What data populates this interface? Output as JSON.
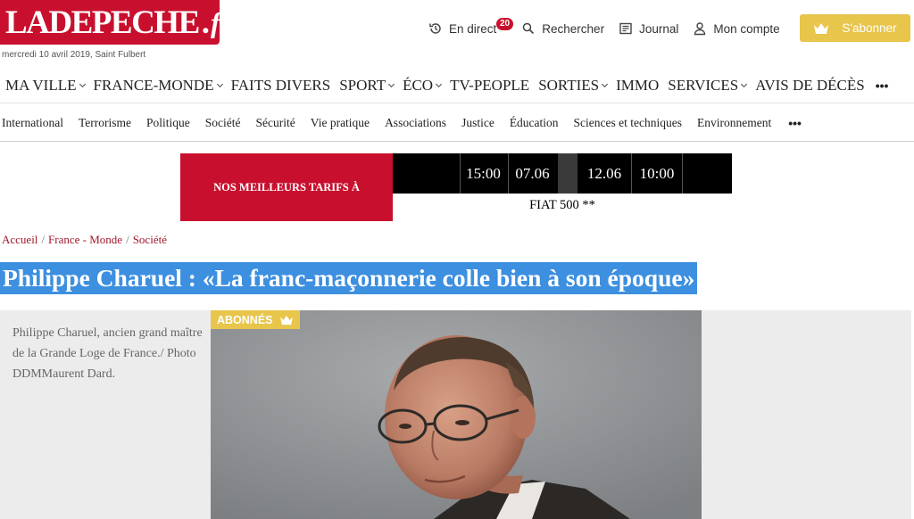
{
  "header": {
    "logo_text": "LADEPECHE",
    "logo_dot": ".",
    "logo_tld": "fr",
    "date": "mercredi 10 avril 2019, Saint Fulbert",
    "actions": {
      "live_label": "En direct",
      "live_count": "20",
      "search_label": "Rechercher",
      "journal_label": "Journal",
      "account_label": "Mon compte"
    },
    "subscribe_label": "S'abonner"
  },
  "main_nav": {
    "items": [
      {
        "label": "MA VILLE"
      },
      {
        "label": "FRANCE-MONDE"
      },
      {
        "label": "FAITS DIVERS"
      },
      {
        "label": "SPORT"
      },
      {
        "label": "ÉCO"
      },
      {
        "label": "TV-PEOPLE"
      },
      {
        "label": "SORTIES"
      },
      {
        "label": "IMMO"
      },
      {
        "label": "SERVICES"
      },
      {
        "label": "AVIS DE DÉCÈS"
      }
    ],
    "more": "•••"
  },
  "sub_nav": {
    "items": [
      {
        "label": "International"
      },
      {
        "label": "Terrorisme"
      },
      {
        "label": "Politique"
      },
      {
        "label": "Société"
      },
      {
        "label": "Sécurité"
      },
      {
        "label": "Vie pratique"
      },
      {
        "label": "Associations"
      },
      {
        "label": "Justice"
      },
      {
        "label": "Éducation"
      },
      {
        "label": "Sciences et techniques"
      },
      {
        "label": "Environnement"
      }
    ],
    "more": "•••"
  },
  "ad": {
    "headline": "NOS MEILLEURS TARIFS À",
    "time1": "15:00",
    "date1": "07.06",
    "date2": "12.06",
    "time2": "10:00",
    "car": "FIAT 500 **"
  },
  "breadcrumb": {
    "home": "Accueil",
    "section": "France - Monde",
    "subsection": "Société",
    "separator": "/"
  },
  "article": {
    "title": "Philippe Charuel : «La franc-maçonnerie colle bien à son époque»",
    "caption": "Philippe Charuel, ancien grand maître de la Grande Loge de France./ Photo DDMMaurent Dard.",
    "badge": "ABONNÉS"
  },
  "colors": {
    "brand_red": "#c8102e",
    "subscribe_gold": "#e8c54b",
    "title_highlight": "#3d8fe0",
    "breadcrumb_link": "#a0182b"
  }
}
